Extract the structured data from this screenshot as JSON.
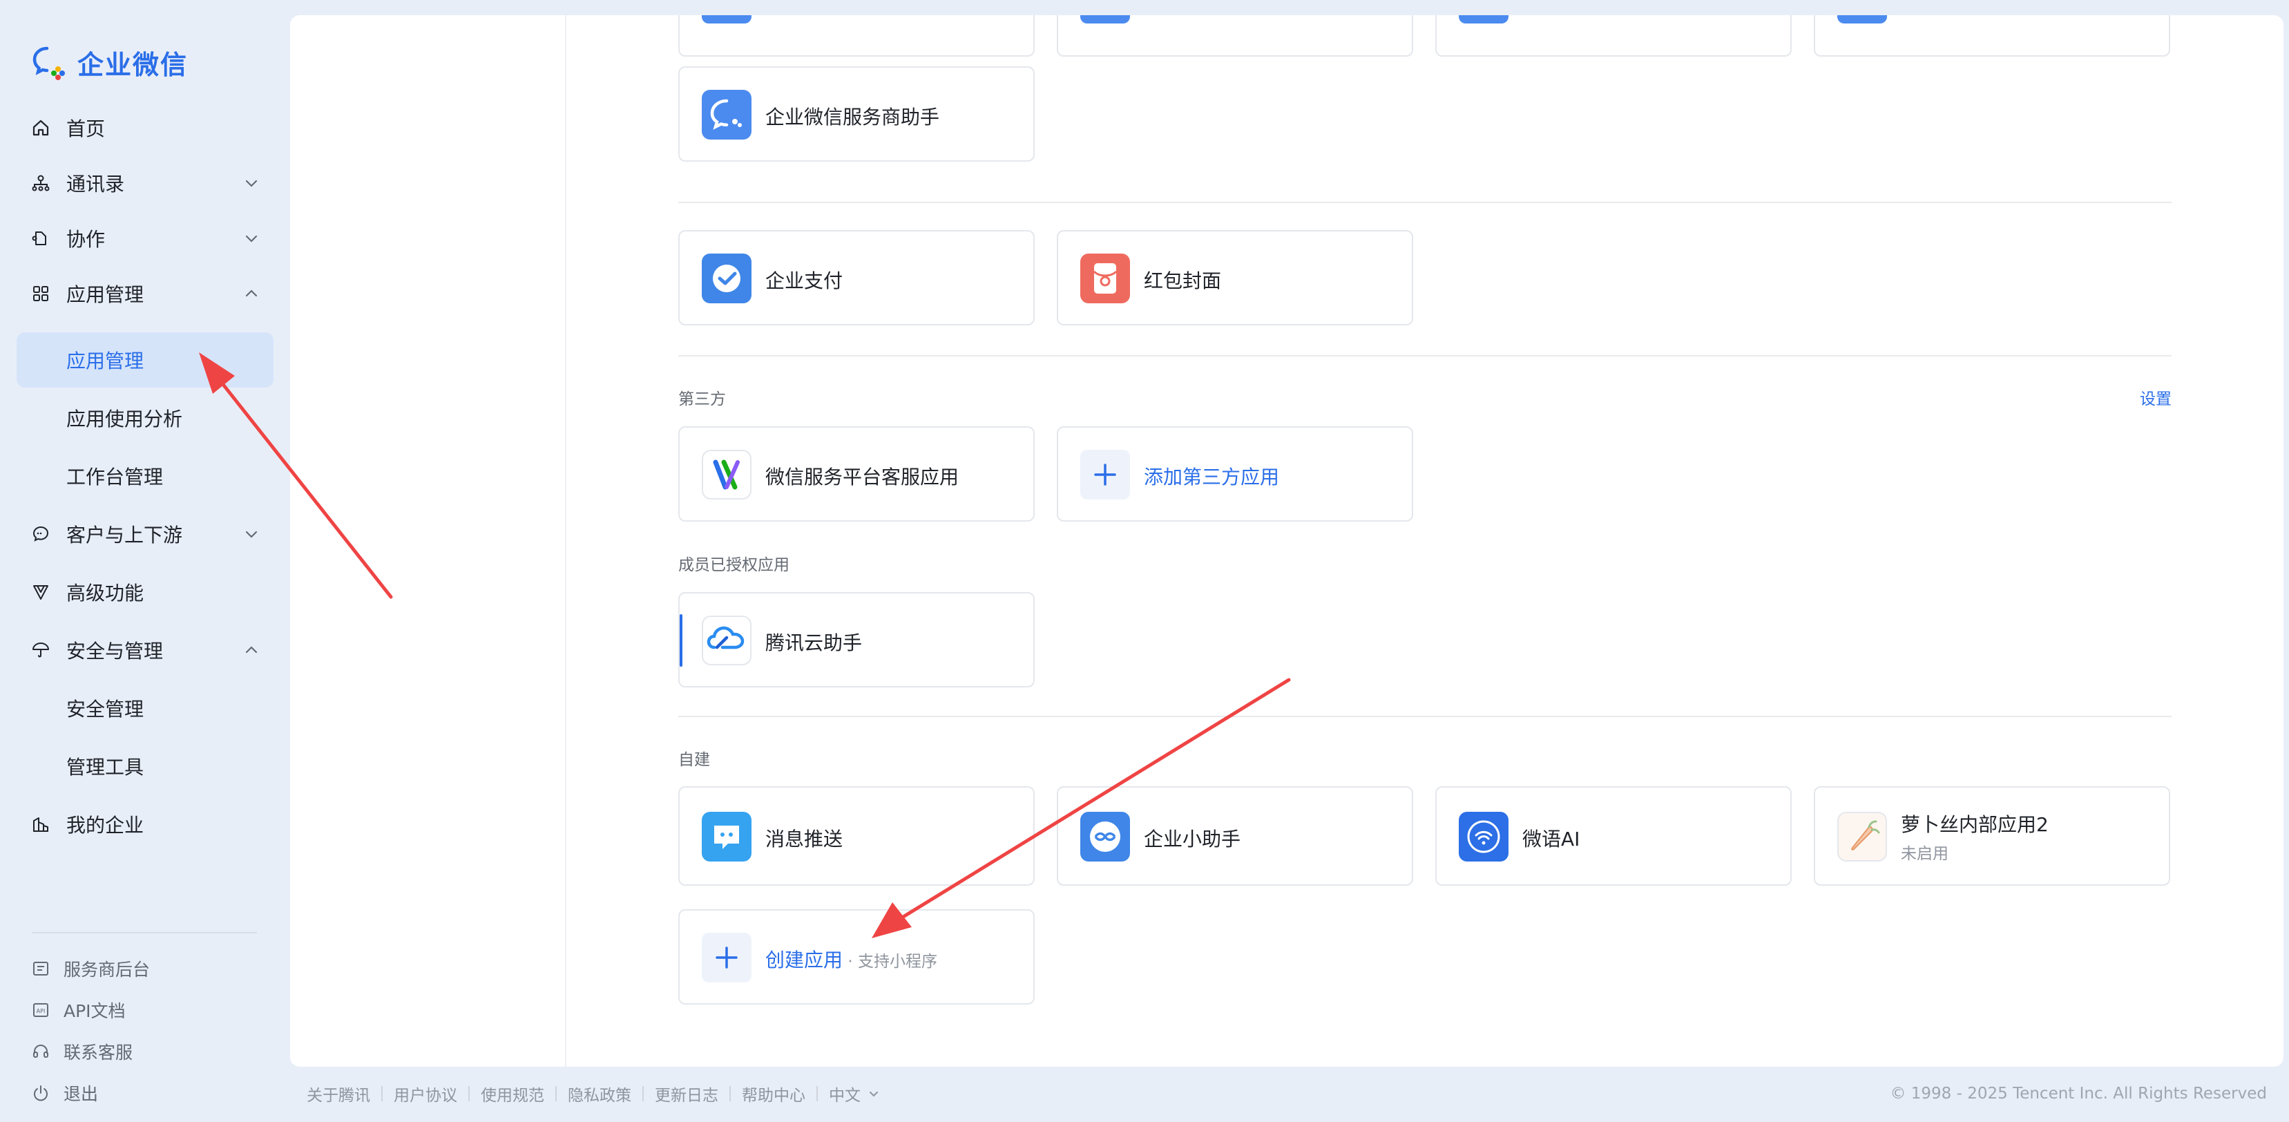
{
  "brand": {
    "name": "企业微信"
  },
  "colors": {
    "accent": "#2a6ee8",
    "arrow": "#ef4444",
    "sidebar_bg": "#e8eef8"
  },
  "sidebar": {
    "items": [
      {
        "label": "首页",
        "icon": "home-icon"
      },
      {
        "label": "通讯录",
        "icon": "org-chart-icon",
        "chevron": "down"
      },
      {
        "label": "协作",
        "icon": "collaboration-icon",
        "chevron": "down"
      },
      {
        "label": "应用管理",
        "icon": "apps-grid-icon",
        "chevron": "up"
      },
      {
        "label": "应用管理",
        "active": true
      },
      {
        "label": "应用使用分析"
      },
      {
        "label": "工作台管理"
      },
      {
        "label": "客户与上下游",
        "icon": "chat-bubble-icon",
        "chevron": "down"
      },
      {
        "label": "高级功能",
        "icon": "advanced-icon"
      },
      {
        "label": "安全与管理",
        "icon": "umbrella-icon",
        "chevron": "up"
      },
      {
        "label": "安全管理"
      },
      {
        "label": "管理工具"
      },
      {
        "label": "我的企业",
        "icon": "building-icon"
      }
    ],
    "bottom_links": [
      {
        "label": "服务商后台",
        "icon": "provider-icon"
      },
      {
        "label": "API文档",
        "icon": "api-doc-icon"
      },
      {
        "label": "联系客服",
        "icon": "headset-icon"
      },
      {
        "label": "退出",
        "icon": "power-icon"
      }
    ]
  },
  "main": {
    "basic_apps": [
      {
        "name": "企业微信服务商助手",
        "icon": "wecom-chat-icon"
      }
    ],
    "payment_apps": [
      {
        "name": "企业支付",
        "icon": "payment-check-icon"
      },
      {
        "name": "红包封面",
        "icon": "red-envelope-icon"
      }
    ],
    "third_party": {
      "title": "第三方",
      "settings_label": "设置",
      "apps": [
        {
          "name": "微信服务平台客服应用",
          "icon": "service-platform-icon"
        }
      ],
      "add_label": "添加第三方应用"
    },
    "authorized": {
      "title": "成员已授权应用",
      "apps": [
        {
          "name": "腾讯云助手",
          "icon": "tencent-cloud-icon"
        }
      ]
    },
    "custom": {
      "title": "自建",
      "apps": [
        {
          "name": "消息推送",
          "icon": "message-push-icon"
        },
        {
          "name": "企业小助手",
          "icon": "assistant-icon"
        },
        {
          "name": "微语AI",
          "icon": "wifi-ai-icon"
        },
        {
          "name": "萝卜丝内部应用2",
          "status": "未启用",
          "icon": "carrot-icon"
        }
      ],
      "create_label": "创建应用",
      "create_sub": " · 支持小程序"
    }
  },
  "footer": {
    "links": [
      "关于腾讯",
      "用户协议",
      "使用规范",
      "隐私政策",
      "更新日志",
      "帮助中心"
    ],
    "language": "中文",
    "copyright": "© 1998 - 2025 Tencent Inc. All Rights Reserved"
  }
}
